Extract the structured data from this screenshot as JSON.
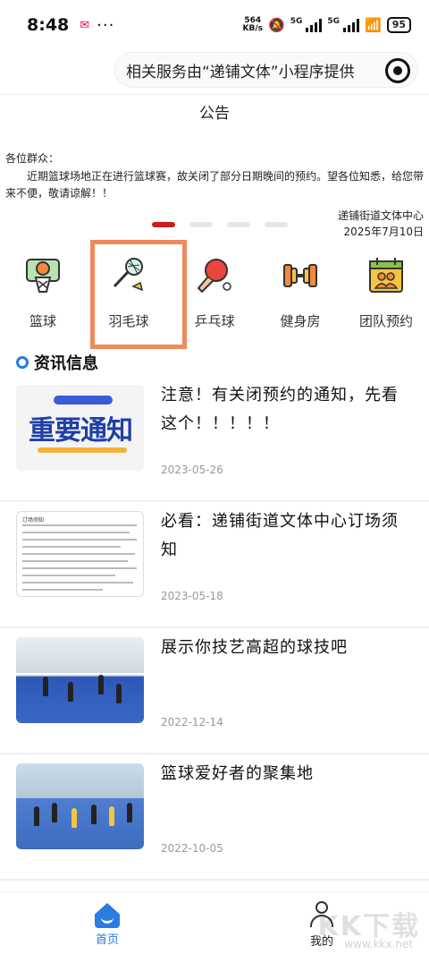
{
  "status_bar": {
    "time": "8:48",
    "net_speed": "564",
    "net_unit": "KB/s",
    "signal1": "5G",
    "signal2": "5G",
    "battery": "95"
  },
  "header": {
    "banner_text": "相关服务由“递铺文体”小程序提供"
  },
  "notice": {
    "title": "公告",
    "greeting": "各位群众：",
    "body": "近期篮球场地正在进行篮球赛，故关闭了部分日期晚间的预约。望各位知悉，给您带来不便，敬请谅解！！",
    "signer": "递铺街道文体中心",
    "date": "2025年7月10日"
  },
  "categories": [
    {
      "label": "篮球",
      "icon": "basketball-hoop-icon"
    },
    {
      "label": "羽毛球",
      "icon": "badminton-icon"
    },
    {
      "label": "乒乓球",
      "icon": "ping-pong-icon"
    },
    {
      "label": "健身房",
      "icon": "dumbbell-icon"
    },
    {
      "label": "团队预约",
      "icon": "team-calendar-icon"
    }
  ],
  "news": {
    "section_title": "资讯信息",
    "items": [
      {
        "title": "注意！有关闭预约的通知，先看这个！！！！！",
        "date": "2023-05-26",
        "thumb_text": "重要通知"
      },
      {
        "title": "必看：递铺街道文体中心订场须知",
        "date": "2023-05-18",
        "thumb_text": "订场须知"
      },
      {
        "title": "展示你技艺高超的球技吧",
        "date": "2022-12-14"
      },
      {
        "title": "篮球爱好者的聚集地",
        "date": "2022-10-05"
      }
    ]
  },
  "tabbar": {
    "home": "首页",
    "me": "我的"
  },
  "watermark": {
    "text": "KK下载",
    "url": "www.kkx.net"
  },
  "colors": {
    "accent": "#2a7be4",
    "dot_active": "#c81e1e",
    "highlight": "#f08a5b"
  }
}
